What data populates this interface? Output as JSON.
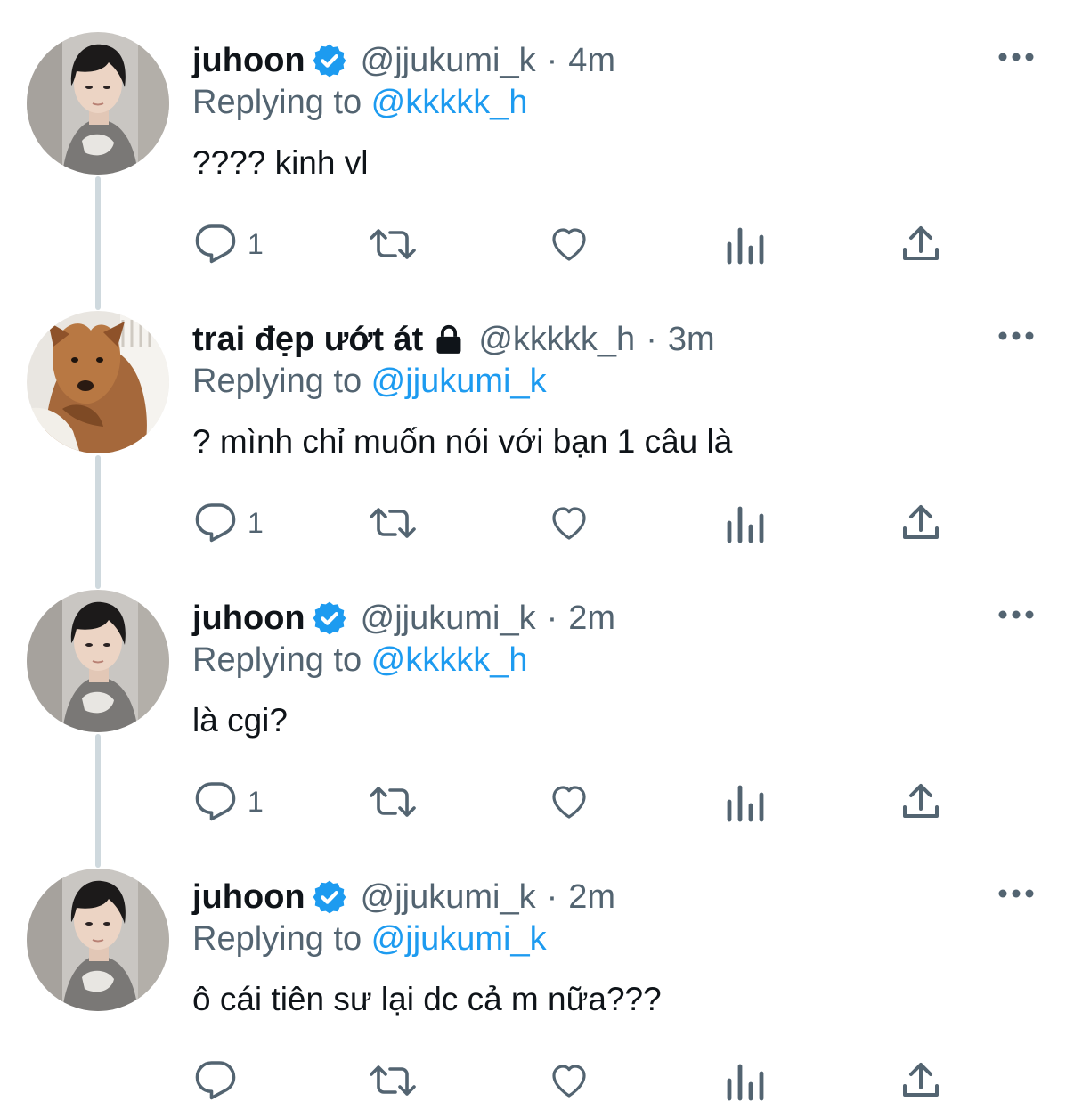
{
  "colors": {
    "link": "#1d9bf0",
    "secondary_text": "#536471",
    "primary_text": "#0f1419",
    "verified_badge": "#1d9bf0",
    "thread_line": "#cfd9de"
  },
  "tweets": [
    {
      "display_name": "juhoon",
      "badge": "verified-icon",
      "handle": "@jjukumi_k",
      "separator": "·",
      "time": "4m",
      "reply_prefix": "Replying to",
      "reply_to": "@kkkkk_h",
      "text": "???? kinh vl",
      "reply_count": "1",
      "avatar": "person-avatar"
    },
    {
      "display_name": "trai đẹp ướt át",
      "badge": "lock-icon",
      "handle": "@kkkkk_h",
      "separator": "·",
      "time": "3m",
      "reply_prefix": "Replying to",
      "reply_to": "@jjukumi_k",
      "text": "? mình chỉ muốn nói với bạn 1 câu là",
      "reply_count": "1",
      "avatar": "dog-avatar"
    },
    {
      "display_name": "juhoon",
      "badge": "verified-icon",
      "handle": "@jjukumi_k",
      "separator": "·",
      "time": "2m",
      "reply_prefix": "Replying to",
      "reply_to": "@kkkkk_h",
      "text": "là cgi?",
      "reply_count": "1",
      "avatar": "person-avatar"
    },
    {
      "display_name": "juhoon",
      "badge": "verified-icon",
      "handle": "@jjukumi_k",
      "separator": "·",
      "time": "2m",
      "reply_prefix": "Replying to",
      "reply_to": "@jjukumi_k",
      "text": "ô cái tiên sư lại dc cả m nữa???",
      "reply_count": "",
      "avatar": "person-avatar"
    }
  ],
  "action_icons": [
    "reply-icon",
    "retweet-icon",
    "like-icon",
    "analytics-icon",
    "share-icon"
  ],
  "more_icon": "more-options-icon"
}
